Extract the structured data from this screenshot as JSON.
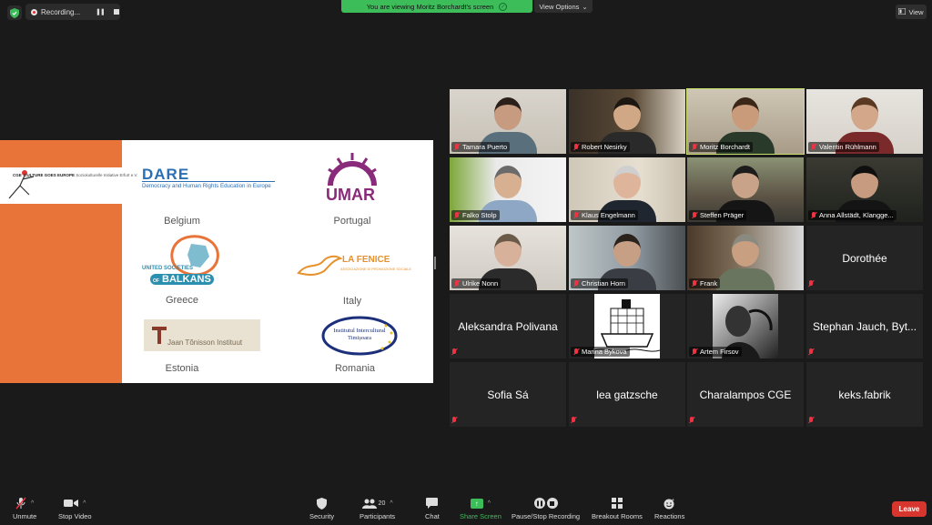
{
  "top": {
    "recording_label": "Recording...",
    "banner_text": "You are viewing Moritz Borchardt's screen",
    "view_options_label": "View Options",
    "view_label": "View"
  },
  "slide": {
    "cge_title": "CULTURE GOES EUROPE",
    "cge_prefix": "CGE",
    "cge_sub": "Soziokulturelle Initiative Erfurt e.V.",
    "dare_title": "DARE",
    "dare_sub": "Democracy and Human Rights Education in Europe",
    "umar_title": "UMAR",
    "usb_label": "UNITED SOCIETIES",
    "usb_of": "OF",
    "usb_balkans": "BALKANS",
    "fenice_title": "LA FENICE",
    "fenice_sub": "ASSOCIAZIONE DI PROMOZIONE SOCIALE",
    "jaan_title": "Jaan Tõnisson Instituut",
    "iit_title1": "Institutul Intercultural",
    "iit_title2": "Timișoara",
    "countries": [
      "Belgium",
      "Portugal",
      "Greece",
      "Italy",
      "Estonia",
      "Romania"
    ]
  },
  "participants": [
    {
      "name": "Tamara Puerto"
    },
    {
      "name": "Robert Nesirky"
    },
    {
      "name": "Moritz Borchardt"
    },
    {
      "name": "Valentin Rühlmann"
    },
    {
      "name": "Falko Stolp"
    },
    {
      "name": "Klaus Engelmann"
    },
    {
      "name": "Steffen Präger"
    },
    {
      "name": "Anna Allstädt, Klangge..."
    },
    {
      "name": "Ulrike Nonn"
    },
    {
      "name": "Christian Horn"
    },
    {
      "name": "Frank"
    },
    {
      "name": "Dorothée"
    },
    {
      "name": "Aleksandra Polivana"
    },
    {
      "name": "Marina Bykova"
    },
    {
      "name": "Artem Firsov"
    },
    {
      "name": "Stephan Jauch, Byt..."
    },
    {
      "name": "Sofia Sá"
    },
    {
      "name": "lea gatzsche"
    },
    {
      "name": "Charalampos CGE"
    },
    {
      "name": "keks.fabrik"
    }
  ],
  "toolbar": {
    "unmute": "Unmute",
    "stop_video": "Stop Video",
    "security": "Security",
    "participants": "Participants",
    "participants_count": "20",
    "chat": "Chat",
    "share_screen": "Share Screen",
    "pause_stop_recording": "Pause/Stop Recording",
    "breakout_rooms": "Breakout Rooms",
    "reactions": "Reactions",
    "leave": "Leave"
  },
  "colors": {
    "banner": "#3dbd5a",
    "active_speaker": "#c7e06b",
    "leave": "#d6362d",
    "slide_accent": "#e8743a"
  }
}
